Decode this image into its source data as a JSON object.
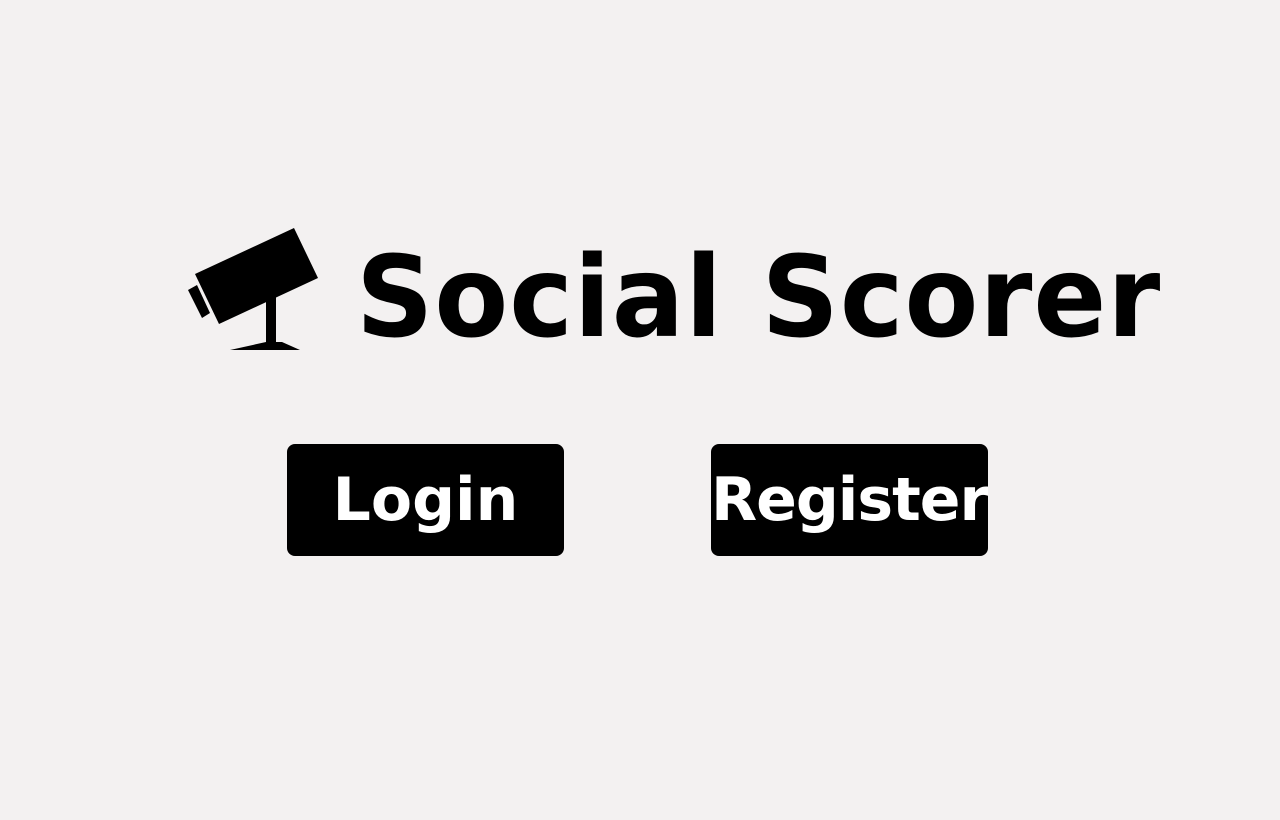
{
  "brand": {
    "title": "Social Scorer",
    "icon": "security-camera-icon"
  },
  "actions": {
    "login_label": "Login",
    "register_label": "Register"
  },
  "colors": {
    "background": "#f3f1f1",
    "button_background": "#000000",
    "button_text": "#ffffff",
    "brand_text": "#000000"
  }
}
